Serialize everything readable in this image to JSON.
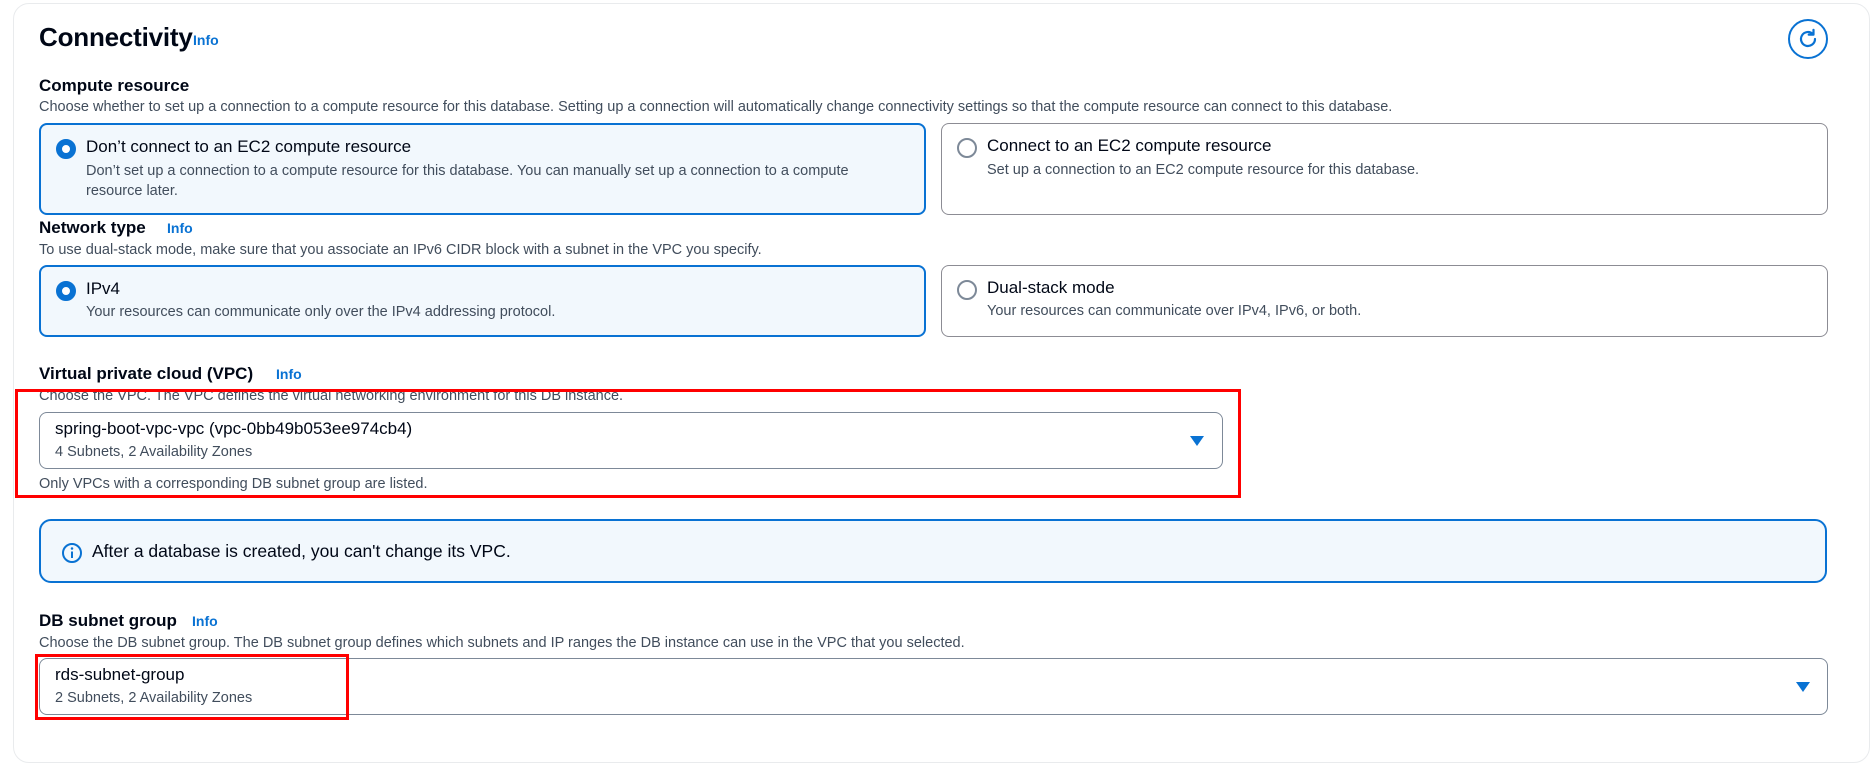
{
  "connectivity": {
    "title": "Connectivity",
    "info_label": "Info",
    "refresh_icon": "refresh-icon"
  },
  "compute_resource": {
    "label": "Compute resource",
    "description": "Choose whether to set up a connection to a compute resource for this database. Setting up a connection will automatically change connectivity settings so that the compute resource can connect to this database.",
    "options": [
      {
        "title": "Don’t connect to an EC2 compute resource",
        "description": "Don’t set up a connection to a compute resource for this database. You can manually set up a connection to a compute resource later.",
        "selected": true
      },
      {
        "title": "Connect to an EC2 compute resource",
        "description": "Set up a connection to an EC2 compute resource for this database.",
        "selected": false
      }
    ]
  },
  "network_type": {
    "label": "Network type",
    "info_label": "Info",
    "description": "To use dual-stack mode, make sure that you associate an IPv6 CIDR block with a subnet in the VPC you specify.",
    "options": [
      {
        "title": "IPv4",
        "description": "Your resources can communicate only over the IPv4 addressing protocol.",
        "selected": true
      },
      {
        "title": "Dual-stack mode",
        "description": "Your resources can communicate over IPv4, IPv6, or both.",
        "selected": false
      }
    ]
  },
  "vpc": {
    "label": "Virtual private cloud (VPC)",
    "info_label": "Info",
    "description": "Choose the VPC. The VPC defines the virtual networking environment for this DB instance.",
    "selected_value": "spring-boot-vpc-vpc (vpc-0bb49b053ee974cb4)",
    "selected_detail": "4 Subnets, 2 Availability Zones",
    "constraint": "Only VPCs with a corresponding DB subnet group are listed."
  },
  "vpc_alert": {
    "icon": "info-circle-icon",
    "text": "After a database is created, you can't change its VPC."
  },
  "db_subnet_group": {
    "label": "DB subnet group",
    "info_label": "Info",
    "description": "Choose the DB subnet group. The DB subnet group defines which subnets and IP ranges the DB instance can use in the VPC that you selected.",
    "selected_value": "rds-subnet-group",
    "selected_detail": "2 Subnets, 2 Availability Zones"
  },
  "colors": {
    "accent": "#0972d3",
    "selected_tile_bg": "#f2f8fd",
    "annotation": "#ff0000"
  }
}
